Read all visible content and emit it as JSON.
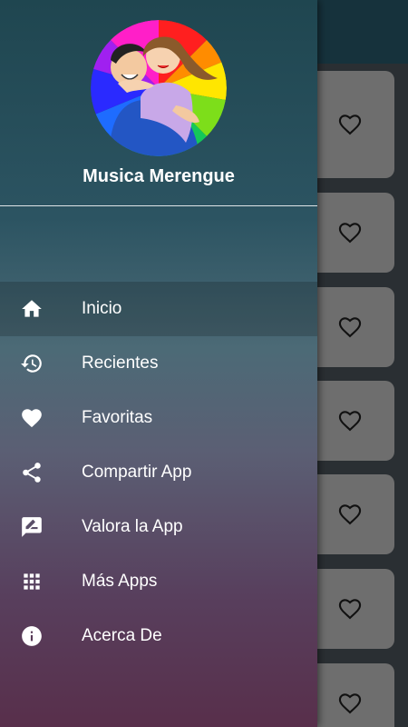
{
  "drawer": {
    "app_name": "Musica Merengue",
    "menu": [
      {
        "label": "Inicio",
        "icon": "home-icon",
        "active": true
      },
      {
        "label": "Recientes",
        "icon": "history-icon",
        "active": false
      },
      {
        "label": "Favoritas",
        "icon": "heart-icon",
        "active": false
      },
      {
        "label": "Compartir App",
        "icon": "share-icon",
        "active": false
      },
      {
        "label": "Valora la App",
        "icon": "rate-review-icon",
        "active": false
      },
      {
        "label": "Más Apps",
        "icon": "apps-grid-icon",
        "active": false
      },
      {
        "label": "Acerca De",
        "icon": "info-icon",
        "active": false
      }
    ]
  },
  "background_list": {
    "favorite_icon": "heart-outline-icon",
    "card_count": 7
  },
  "colors": {
    "card": "#6e6e6e",
    "active_item": "rgba(0,0,0,0.18)"
  }
}
